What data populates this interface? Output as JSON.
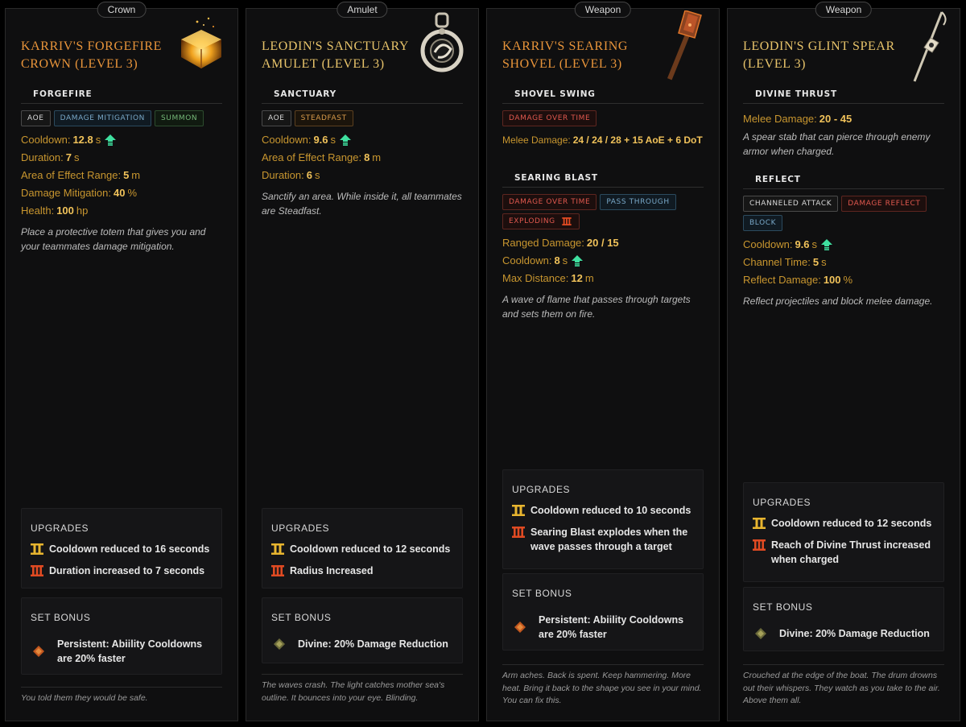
{
  "cards": [
    {
      "category": "Crown",
      "title": "Karriv's Forgefire Crown (Level 3)",
      "abilities": [
        {
          "name": "FORGEFIRE",
          "tags": [
            "AOE",
            "DAMAGE MITIGATION",
            "SUMMON"
          ],
          "stats": [
            {
              "label": "Cooldown:",
              "value": "12.8",
              "unit": "s",
              "upgraded": true
            },
            {
              "label": "Duration:",
              "value": "7",
              "unit": "s"
            },
            {
              "label": "Area of Effect Range:",
              "value": "5",
              "unit": "m"
            },
            {
              "label": "Damage Mitigation:",
              "value": "40",
              "unit": "%"
            },
            {
              "label": "Health:",
              "value": "100",
              "unit": " hp"
            }
          ],
          "description": "Place a protective totem that gives you and your teammates damage mitigation."
        }
      ],
      "upgrades_title": "UPGRADES",
      "upgrades": [
        "Cooldown reduced to 16 seconds",
        "Duration increased to 7 seconds"
      ],
      "set_bonus_title": "SET BONUS",
      "set_bonus": "Persistent: Abiility Cooldowns are 20% faster",
      "lore": "You told them they would be safe."
    },
    {
      "category": "Amulet",
      "title": "Leodin's Sanctuary Amulet (Level 3)",
      "abilities": [
        {
          "name": "SANCTUARY",
          "tags": [
            "AOE",
            "STEADFAST"
          ],
          "stats": [
            {
              "label": "Cooldown:",
              "value": "9.6",
              "unit": "s",
              "upgraded": true
            },
            {
              "label": "Area of Effect Range:",
              "value": "8",
              "unit": "m"
            },
            {
              "label": "Duration:",
              "value": "6",
              "unit": "s"
            }
          ],
          "description": "Sanctify an area. While inside it, all teammates are Steadfast."
        }
      ],
      "upgrades_title": "UPGRADES",
      "upgrades": [
        "Cooldown reduced to 12 seconds",
        "Radius Increased"
      ],
      "set_bonus_title": "SET BONUS",
      "set_bonus": "Divine: 20% Damage Reduction",
      "lore": "The waves crash. The light catches mother sea's outline. It bounces into your eye. Blinding."
    },
    {
      "category": "Weapon",
      "title": "Karriv's Searing Shovel (Level 3)",
      "abilities": [
        {
          "name": "SHOVEL SWING",
          "tags": [
            "DAMAGE OVER TIME"
          ],
          "stats": [
            {
              "label": "Melee Damage:",
              "value": "24 / 24 / 28 + 15 AoE + 6 DoT",
              "unit": ""
            }
          ],
          "description": ""
        },
        {
          "name": "SEARING BLAST",
          "tags": [
            "DAMAGE OVER TIME",
            "PASS THROUGH",
            "EXPLODING"
          ],
          "stats": [
            {
              "label": "Ranged Damage:",
              "value": "20 / 15",
              "unit": ""
            },
            {
              "label": "Cooldown:",
              "value": "8",
              "unit": "s",
              "upgraded": true
            },
            {
              "label": "Max Distance:",
              "value": "12",
              "unit": "m"
            }
          ],
          "description": "A wave of flame that passes through targets and sets them on fire."
        }
      ],
      "upgrades_title": "UPGRADES",
      "upgrades": [
        "Cooldown reduced to 10 seconds",
        "Searing Blast explodes when the wave passes through a target"
      ],
      "set_bonus_title": "SET BONUS",
      "set_bonus": "Persistent: Abiility Cooldowns are 20% faster",
      "lore": "Arm aches. Back is spent. Keep hammering. More heat. Bring it back to the shape you see in your mind. You can fix this."
    },
    {
      "category": "Weapon",
      "title": "Leodin's Glint Spear (Level 3)",
      "abilities": [
        {
          "name": "DIVINE THRUST",
          "tags": [],
          "stats": [
            {
              "label": "Melee Damage:",
              "value": "20 - 45",
              "unit": ""
            }
          ],
          "description": "A spear stab that can pierce through enemy armor when charged."
        },
        {
          "name": "REFLECT",
          "tags": [
            "CHANNELED ATTACK",
            "DAMAGE REFLECT",
            "BLOCK"
          ],
          "stats": [
            {
              "label": "Cooldown:",
              "value": "9.6",
              "unit": "s",
              "upgraded": true
            },
            {
              "label": "Channel Time:",
              "value": "5",
              "unit": "s"
            },
            {
              "label": "Reflect Damage:",
              "value": "100",
              "unit": "%"
            }
          ],
          "description": "Reflect projectiles and block melee damage."
        }
      ],
      "upgrades_title": "UPGRADES",
      "upgrades": [
        "Cooldown reduced to 12 seconds",
        "Reach of Divine Thrust increased when charged"
      ],
      "set_bonus_title": "SET BONUS",
      "set_bonus": "Divine: 20% Damage Reduction",
      "lore": "Crouched at the edge of the boat. The drum drowns out their whispers. They watch as you take to the air. Above them all."
    }
  ],
  "icons": {
    "upgrade_arrow": "upgrade-arrow-icon",
    "tier_2": "roman-two-icon",
    "tier_3": "roman-three-icon",
    "set_bonus": "diamond-icon"
  },
  "colors": {
    "title_orange": "#e8943a",
    "title_gold": "#e7c36a",
    "stat_label": "#c8962f",
    "stat_value": "#f0c25a",
    "upgrade_arrow": "#3fe0a0"
  }
}
